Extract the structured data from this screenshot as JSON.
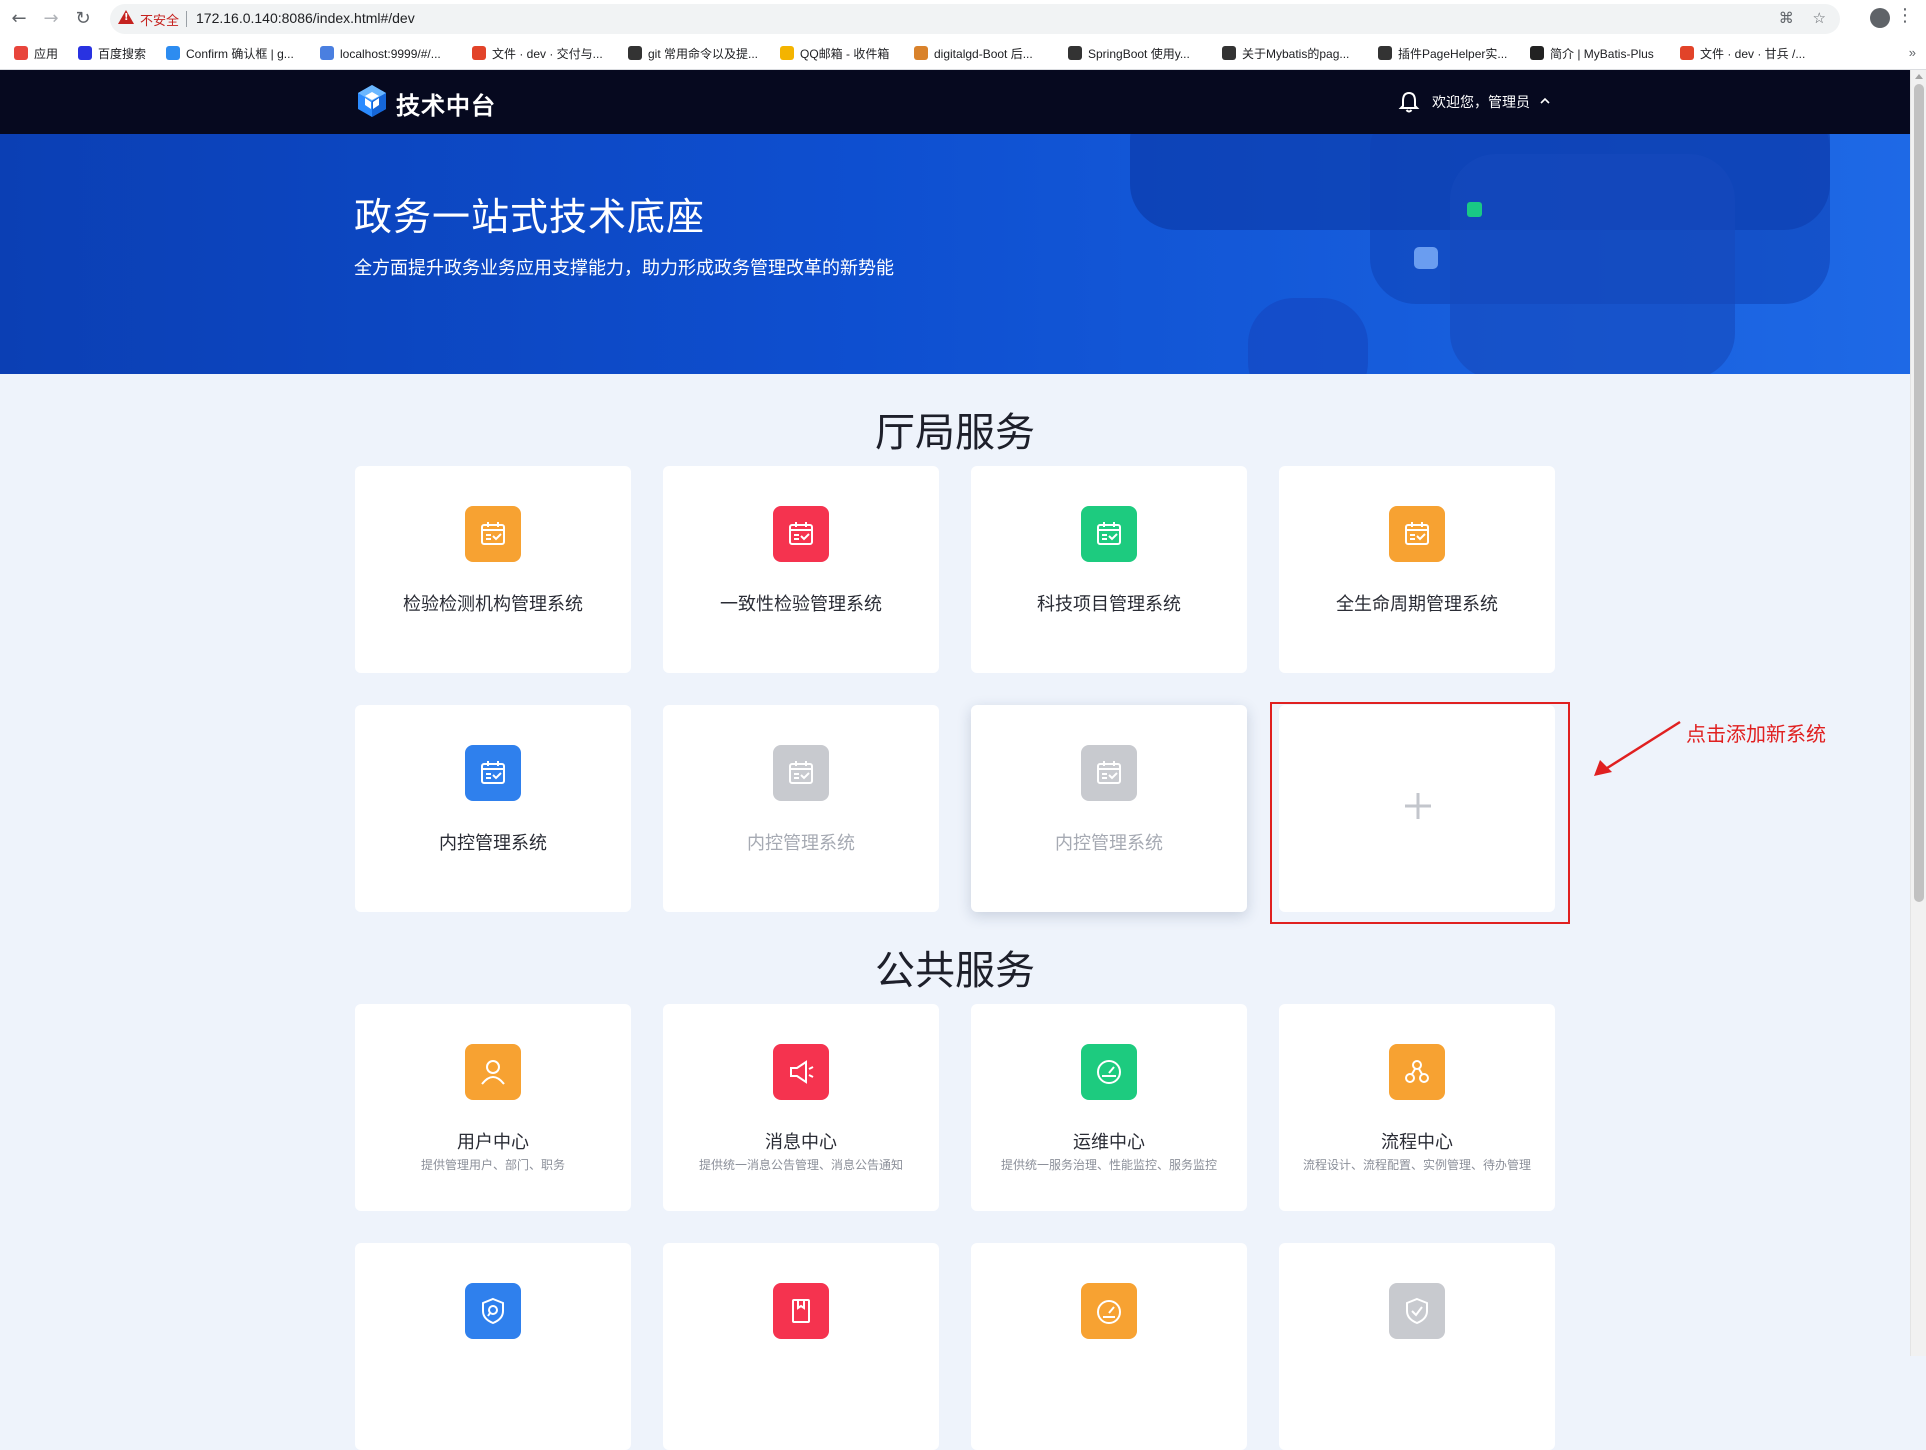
{
  "browser": {
    "insecure_label": "不安全",
    "url": "172.16.0.140:8086/index.html#/dev",
    "bookmarks": [
      {
        "label": "应用",
        "color": "#e8453c"
      },
      {
        "label": "百度搜索",
        "color": "#2932e1"
      },
      {
        "label": "Confirm 确认框 | g...",
        "color": "#2d8cf0"
      },
      {
        "label": "localhost:9999/#/...",
        "color": "#4a7fe0"
      },
      {
        "label": "文件 · dev · 交付与...",
        "color": "#e24329"
      },
      {
        "label": "git 常用命令以及提...",
        "color": "#333333"
      },
      {
        "label": "QQ邮箱 - 收件箱",
        "color": "#f4b400"
      },
      {
        "label": "digitalgd-Boot 后...",
        "color": "#d9822b"
      },
      {
        "label": "SpringBoot 使用y...",
        "color": "#333333"
      },
      {
        "label": "关于Mybatis的pag...",
        "color": "#333333"
      },
      {
        "label": "插件PageHelper实...",
        "color": "#333333"
      },
      {
        "label": "简介 | MyBatis-Plus",
        "color": "#222222"
      },
      {
        "label": "文件 · dev · 甘兵 /...",
        "color": "#e24329"
      }
    ],
    "more": "»"
  },
  "header": {
    "logo_text": "技术中台",
    "welcome": "欢迎您，管理员"
  },
  "banner": {
    "title": "政务一站式技术底座",
    "subtitle": "全方面提升政务业务应用支撑能力，助力形成政务管理改革的新势能"
  },
  "sections": {
    "hall": {
      "title": "厅局服务",
      "cards": [
        {
          "name": "检验检测机构管理系统",
          "icon": "calendar-check-icon",
          "color": "#f7a232"
        },
        {
          "name": "一致性检验管理系统",
          "icon": "calendar-check-icon",
          "color": "#f5334f"
        },
        {
          "name": "科技项目管理系统",
          "icon": "calendar-check-icon",
          "color": "#1dcb7f"
        },
        {
          "name": "全生命周期管理系统",
          "icon": "calendar-check-icon",
          "color": "#f7a232"
        },
        {
          "name": "内控管理系统",
          "icon": "calendar-check-icon",
          "color": "#2f80ed"
        },
        {
          "name": "内控管理系统",
          "icon": "calendar-check-icon",
          "color": "#c8cacf"
        },
        {
          "name": "内控管理系统",
          "icon": "calendar-check-icon",
          "color": "#c8cacf"
        }
      ],
      "add_symbol": "+"
    },
    "public": {
      "title": "公共服务",
      "cards": [
        {
          "name": "用户中心",
          "desc": "提供管理用户、部门、职务",
          "icon": "user-icon",
          "color": "#f7a232"
        },
        {
          "name": "消息中心",
          "desc": "提供统一消息公告管理、消息公告通知",
          "icon": "megaphone-icon",
          "color": "#f5334f"
        },
        {
          "name": "运维中心",
          "desc": "提供统一服务治理、性能监控、服务监控",
          "icon": "gauge-icon",
          "color": "#1dcb7f"
        },
        {
          "name": "流程中心",
          "desc": "流程设计、流程配置、实例管理、待办管理",
          "icon": "flow-icon",
          "color": "#f7a232"
        },
        {
          "name": "",
          "desc": "",
          "icon": "shield-search-icon",
          "color": "#2f80ed"
        },
        {
          "name": "",
          "desc": "",
          "icon": "book-icon",
          "color": "#f5334f"
        },
        {
          "name": "",
          "desc": "",
          "icon": "speedometer-icon",
          "color": "#f7a232"
        },
        {
          "name": "",
          "desc": "",
          "icon": "shield-check-icon",
          "color": "#c8cacf"
        }
      ]
    }
  },
  "annotation": {
    "text": "点击添加新系统"
  }
}
